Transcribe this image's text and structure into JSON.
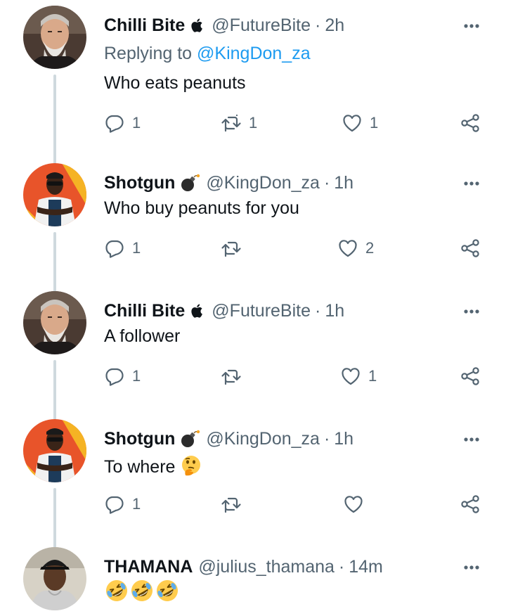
{
  "tweets": [
    {
      "name": "Chilli Bite",
      "badge_icon": "apple-icon",
      "handle": "@FutureBite",
      "separator": "·",
      "time": "2h",
      "replying_prefix": "Replying to",
      "replying_mention": "@KingDon_za",
      "text": "Who eats peanuts",
      "reply_count": "1",
      "retweet_count": "1",
      "like_count": "1"
    },
    {
      "name": "Shotgun",
      "badge_icon": "bomb-icon",
      "handle": "@KingDon_za",
      "separator": "·",
      "time": "1h",
      "text": "Who buy peanuts for you",
      "reply_count": "1",
      "retweet_count": "",
      "like_count": "2"
    },
    {
      "name": "Chilli Bite",
      "badge_icon": "apple-icon",
      "handle": "@FutureBite",
      "separator": "·",
      "time": "1h",
      "text": "A follower",
      "reply_count": "1",
      "retweet_count": "",
      "like_count": "1"
    },
    {
      "name": "Shotgun",
      "badge_icon": "bomb-icon",
      "handle": "@KingDon_za",
      "separator": "·",
      "time": "1h",
      "text": "To where",
      "text_emoji": "thinking-face-emoji",
      "reply_count": "1",
      "retweet_count": "",
      "like_count": ""
    },
    {
      "name": "THAMANA",
      "handle": "@julius_thamana",
      "separator": "·",
      "time": "14m",
      "text_emoji": "rolling-on-floor-laughing-emoji x3"
    }
  ],
  "colors": {
    "text": "#0f1419",
    "secondary": "#536471",
    "link": "#1d9bf0",
    "thread_line": "#cfd9de"
  }
}
